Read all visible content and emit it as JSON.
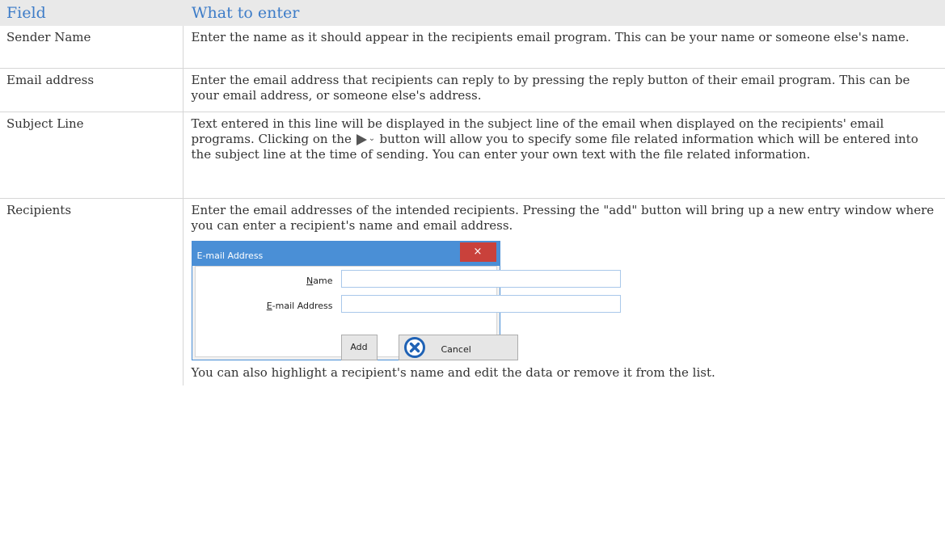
{
  "header": {
    "field": "Field",
    "what": "What to enter"
  },
  "rows": [
    {
      "field": "Sender Name",
      "desc": "Enter the name as it should appear in the recipients email program. This can be your name or someone else's name."
    },
    {
      "field": "Email address",
      "desc": "Enter the email address that recipients can reply to by pressing the reply button of their email program. This can be your email address, or someone else's address."
    },
    {
      "field": "Subject Line",
      "desc_before": "Text entered in this line will be displayed in the subject line of the email when displayed on the recipients' email programs. Clicking on the",
      "desc_icon": "play-dropdown-icon",
      "desc_after": "button will allow you to specify some file related information which will be entered into the subject line at the time of sending. You can enter your own text with the file related information."
    },
    {
      "field": "Recipients",
      "desc": "Enter the email addresses of the intended recipients. Pressing the \"add\" button will bring up a new entry window where you can enter a recipient's name and email address.",
      "desc_after": "You can also highlight a recipient's name and edit the data or remove it from the list."
    }
  ],
  "dialog": {
    "title": "E-mail Address",
    "close": "×",
    "name_label_accel": "N",
    "name_label_rest": "ame",
    "email_label_accel": "E",
    "email_label_rest": "-mail Address",
    "name_value": "",
    "email_value": "",
    "add_label": "Add",
    "cancel_label": "Cancel",
    "title_bar_color": "#4a8fd6",
    "close_color": "#c9413b"
  },
  "colors": {
    "header_text": "#3d7cc8",
    "header_bg": "#e9e9e9",
    "body_text": "#333333",
    "cancel_icon": "#1f62b5"
  }
}
